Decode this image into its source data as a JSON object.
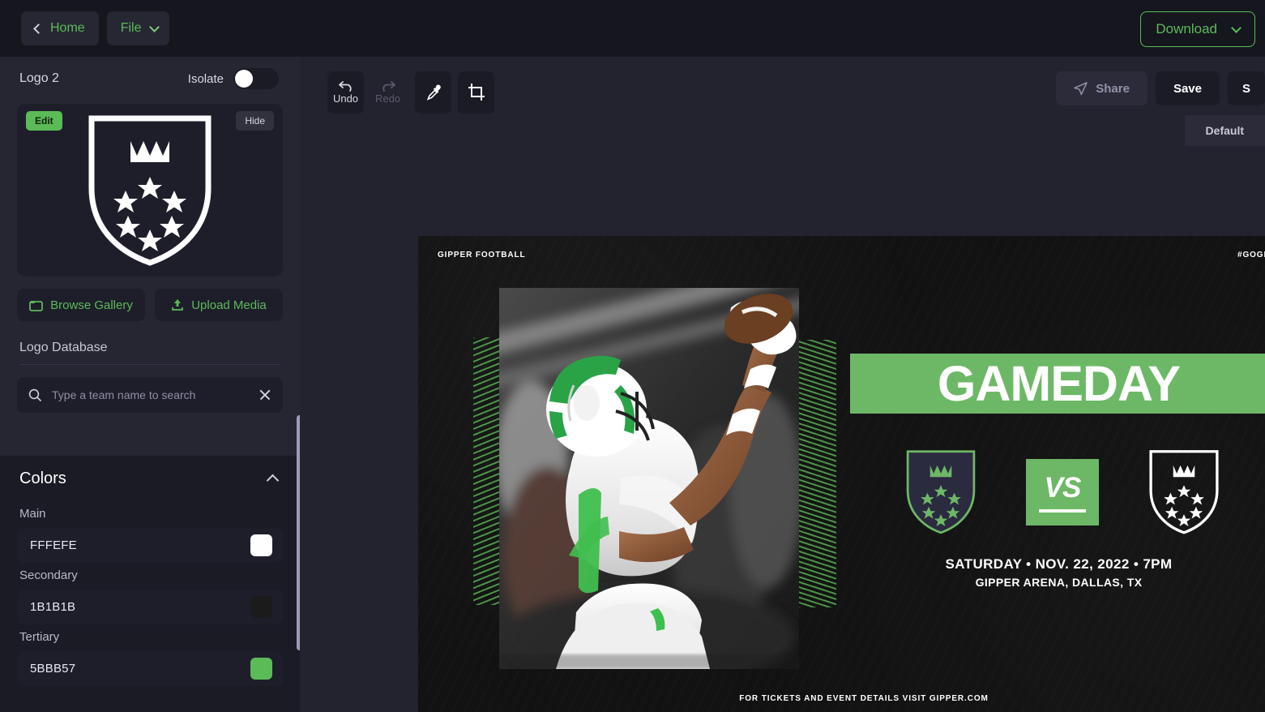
{
  "topbar": {
    "home_label": "Home",
    "file_label": "File",
    "download_label": "Download"
  },
  "sidebar": {
    "layer_title": "Logo 2",
    "isolate_label": "Isolate",
    "isolate_on": false,
    "edit_label": "Edit",
    "hide_label": "Hide",
    "browse_gallery_label": "Browse Gallery",
    "upload_media_label": "Upload Media",
    "logo_database_label": "Logo Database",
    "search_placeholder": "Type a team name to search",
    "search_value": "",
    "colors": {
      "title": "Colors",
      "main_label": "Main",
      "main_hex": "FFFEFE",
      "main_color": "#FFFEFE",
      "secondary_label": "Secondary",
      "secondary_hex": "1B1B1B",
      "secondary_color": "#1B1B1B",
      "tertiary_label": "Tertiary",
      "tertiary_hex": "5BBB57",
      "tertiary_color": "#5BBB57"
    }
  },
  "toolbar": {
    "undo_label": "Undo",
    "redo_label": "Redo",
    "share_label": "Share",
    "save_label": "Save",
    "more_label": "S",
    "tab_default_label": "Default"
  },
  "design": {
    "brand": "GIPPER FOOTBALL",
    "hashtag": "#GOGIPPER",
    "headline": "GAMEDAY",
    "vs_label": "VS",
    "date_line": "SATURDAY • NOV. 22, 2022 • 7PM",
    "venue_line": "GIPPER ARENA, DALLAS, TX",
    "footer": "FOR TICKETS AND EVENT DETAILS VISIT GIPPER.COM",
    "accent_green": "#6DB866",
    "shield_left_fill": "#2B2B40",
    "shield_left_stroke": "#6DB866",
    "shield_right_stroke": "#FFFFFF"
  }
}
